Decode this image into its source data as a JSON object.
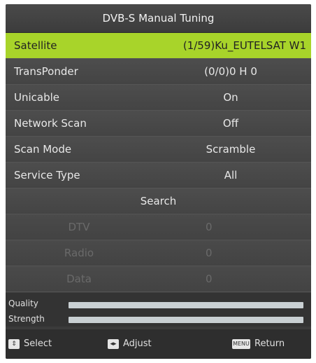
{
  "title": "DVB-S Manual Tuning",
  "rows": [
    {
      "label": "Satellite",
      "value": "(1/59)Ku_EUTELSAT W1"
    },
    {
      "label": "TransPonder",
      "value": "(0/0)0 H 0"
    },
    {
      "label": "Unicable",
      "value": "On"
    },
    {
      "label": "Network Scan",
      "value": "Off"
    },
    {
      "label": "Scan Mode",
      "value": "Scramble"
    },
    {
      "label": "Service Type",
      "value": "All"
    }
  ],
  "search_label": "Search",
  "results": [
    {
      "label": "DTV",
      "value": "0"
    },
    {
      "label": "Radio",
      "value": "0"
    },
    {
      "label": "Data",
      "value": "0"
    }
  ],
  "meters": {
    "quality_label": "Quality",
    "strength_label": "Strength"
  },
  "footer": {
    "select": "Select",
    "adjust": "Adjust",
    "return": "Return",
    "menu_key": "MENU"
  },
  "colors": {
    "highlight": "#a8d42a"
  }
}
